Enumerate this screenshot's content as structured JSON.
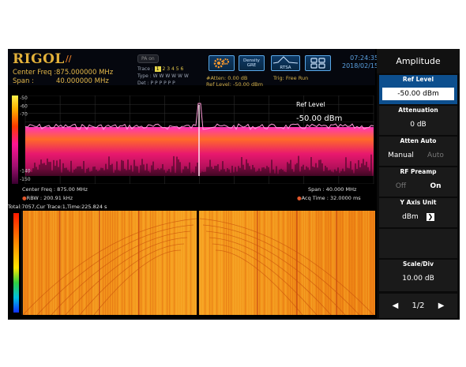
{
  "header": {
    "logo": "RIGOL",
    "center_freq_label": "Center Freq :",
    "center_freq_value": "875.000000 MHz",
    "span_label": "Span :",
    "span_value": "40.000000 MHz",
    "pa_label": "PA on",
    "trace_label": "Trace :",
    "trace_numbers": [
      "1",
      "2",
      "3",
      "4",
      "5",
      "6"
    ],
    "type_label": "Type :",
    "type_values": "W  W  W  W  W  W",
    "det_label": "Det :",
    "det_values": "P  P  P  P  P  P",
    "atten": "#Atten: 0.00 dB",
    "ref_level_info": "Ref Level: -50.00 dBm",
    "trig": "Trig: Free Run",
    "btn_density": "Density\nGRE",
    "btn_rtsa": "RTSA",
    "time": "07:24:35",
    "date": "2018/02/15"
  },
  "spectrum": {
    "y_ticks": [
      "-50",
      "-60",
      "-70",
      "-80",
      "-90",
      "-100",
      "-110",
      "-120",
      "-130",
      "-140",
      "-150"
    ],
    "ref_label": "Ref Level",
    "ref_value": "-50.00 dBm",
    "center_freq": "Center Freq : 875.00 MHz",
    "rbw": "RBW : 200.91 kHz",
    "span": "Span : 40.000 MHz",
    "acq_time": "Acq Time : 32.0000 ms"
  },
  "waterfall": {
    "title": "Total:7057,Cur Trace:1,Time:225.824 s"
  },
  "side_menu": {
    "title": "Amplitude",
    "ref_level_label": "Ref Level",
    "ref_level_value": "-50.00 dBm",
    "attenuation_label": "Attenuation",
    "attenuation_value": "0 dB",
    "atten_auto_label": "Atten Auto",
    "atten_auto_manual": "Manual",
    "atten_auto_auto": "Auto",
    "rf_preamp_label": "RF Preamp",
    "rf_preamp_off": "Off",
    "rf_preamp_on": "On",
    "y_axis_unit_label": "Y Axis Unit",
    "y_axis_unit_value": "dBm",
    "scale_div_label": "Scale/Div",
    "scale_div_value": "10.00 dB",
    "page": "1/2"
  },
  "colors": {
    "logo": "#e3b13a",
    "spectrum_peak": "#ff2ab8",
    "accent_blue": "#0d4f8e"
  }
}
